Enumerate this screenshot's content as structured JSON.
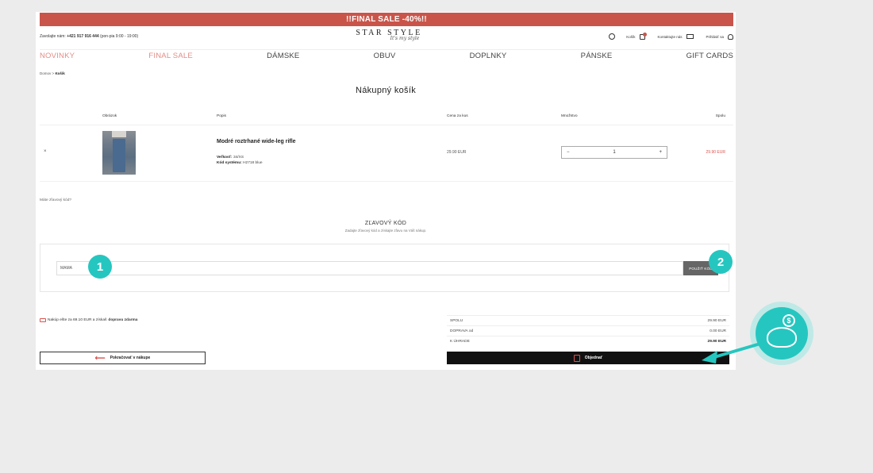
{
  "banner": {
    "text": "!!FINAL SALE -40%!!"
  },
  "header": {
    "call_prefix": "Zavolajte nám:",
    "phone": "+421 917 916 444",
    "hours": "(pon-pia 9:00 - 19:00)",
    "logo_main": "STAR STYLE",
    "logo_sub": "It's my style",
    "cart_label": "Košík",
    "contact_label": "Kontaktujte nás",
    "login_label": "Prihlásiť sa"
  },
  "nav": {
    "items": [
      "NOVINKY",
      "FINAL SALE",
      "DÁMSKE",
      "OBUV",
      "DOPLNKY",
      "PÁNSKE",
      "GIFT CARDS"
    ]
  },
  "breadcrumb": {
    "home": "Domov",
    "sep": ">",
    "current": "Košík"
  },
  "title": "Nákupný košík",
  "table": {
    "headers": {
      "image": "Obrázok",
      "name": "Popis",
      "price": "Cena za kus",
      "qty": "Množstvo",
      "total": "Spolu"
    }
  },
  "item": {
    "remove": "×",
    "name": "Modré roztrhané wide-leg rifle",
    "size_label": "Veľkosť:",
    "size_value": "34/XS",
    "code_label": "Kód systému:",
    "code_value": "H2718 blue",
    "unit_price": "29.90 EUR",
    "qty_minus": "−",
    "qty_value": "1",
    "qty_plus": "+",
    "total": "29.90 EUR"
  },
  "discount": {
    "have_code": "Máte zľavový kód?",
    "title": "ZĽAVOVÝ KÓD",
    "subtitle": "Zadajte zľavový kód a získajte zľavu na Váš nákup.",
    "input_value": "MAMA",
    "apply_label": "POUŽIŤ KÓD"
  },
  "shipping_note": {
    "prefix": "Nakúp ešte za 69.10 EUR a získaš",
    "bold": "dopravu zdarma"
  },
  "summary": {
    "rows": [
      {
        "label": "SPOLU",
        "value": "29.90 EUR"
      },
      {
        "label": "DOPRAVA od",
        "value": "0.00 EUR"
      },
      {
        "label": "K ÚHRADE",
        "value": "29.90 EUR"
      }
    ]
  },
  "buttons": {
    "continue": "Pokračovať v nákupe",
    "order": "Objednať"
  },
  "markers": {
    "one": "1",
    "two": "2",
    "coin": "$"
  },
  "colors": {
    "banner": "#c9554a",
    "accent": "#26c6c0",
    "sale": "#e38c86",
    "price": "#d9534f"
  }
}
